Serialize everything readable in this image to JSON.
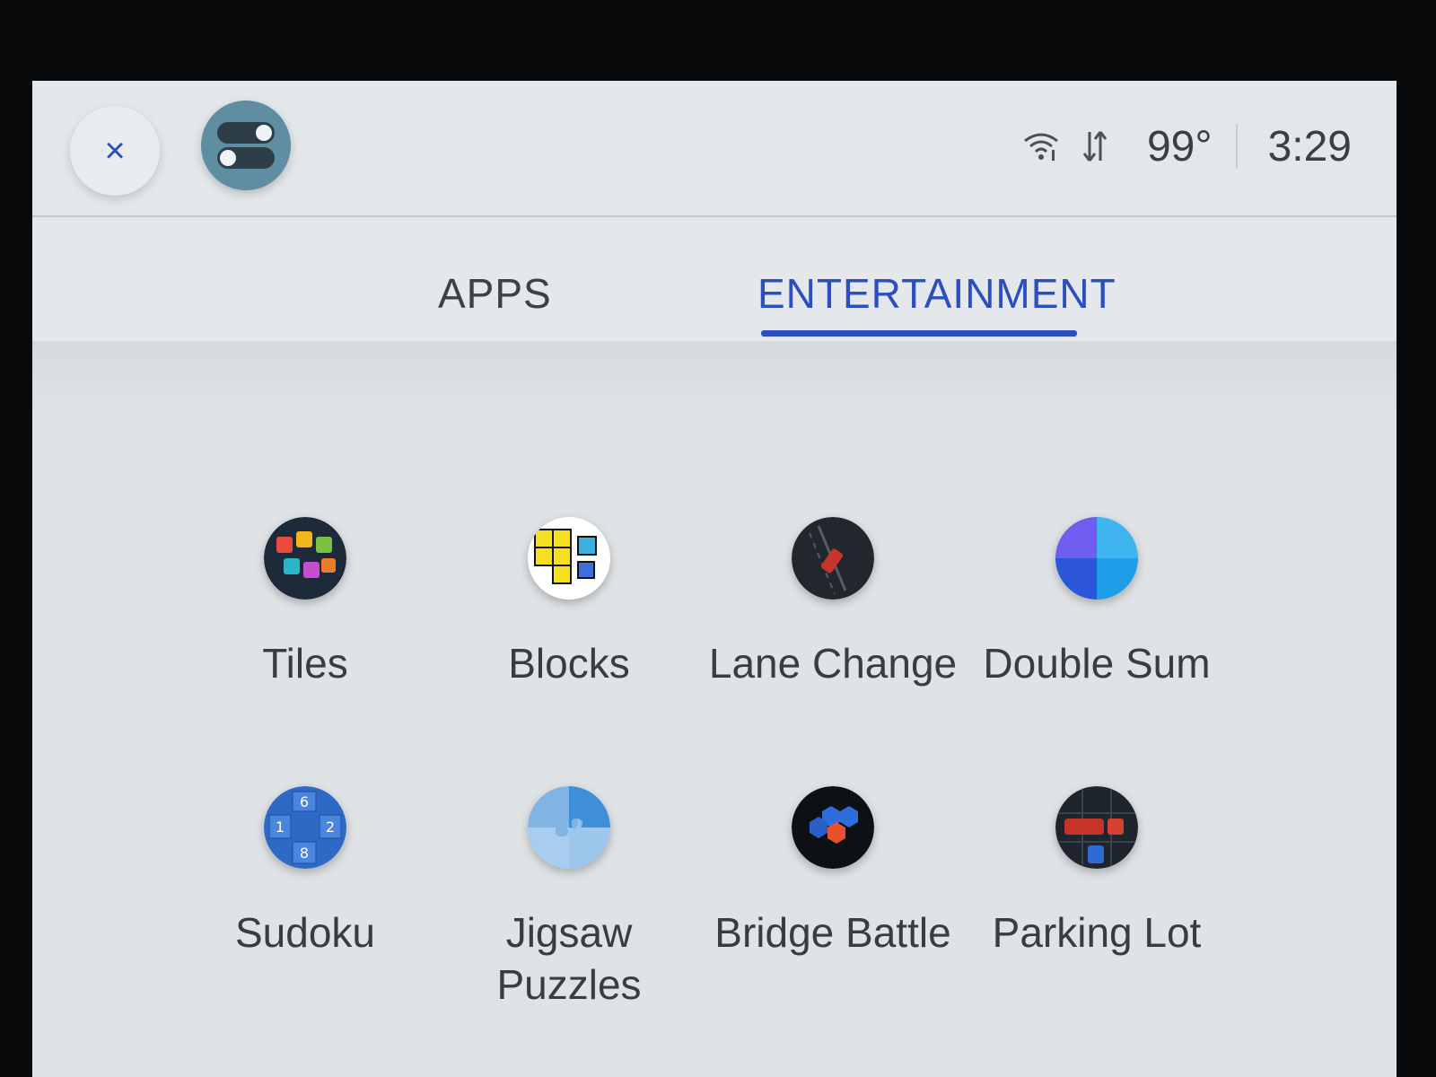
{
  "header": {
    "close_icon": "×",
    "temperature": "99°",
    "time": "3:29"
  },
  "tabs": [
    {
      "label": "APPS",
      "active": false
    },
    {
      "label": "ENTERTAINMENT",
      "active": true
    }
  ],
  "colors": {
    "accent": "#2c4fbd"
  },
  "apps": [
    {
      "label": "Tiles",
      "icon": "tiles-icon"
    },
    {
      "label": "Blocks",
      "icon": "blocks-icon"
    },
    {
      "label": "Lane Change",
      "icon": "lane-change-icon"
    },
    {
      "label": "Double Sum",
      "icon": "double-sum-icon"
    },
    {
      "label": "Sudoku",
      "icon": "sudoku-icon"
    },
    {
      "label": "Jigsaw Puzzles",
      "icon": "jigsaw-icon"
    },
    {
      "label": "Bridge Battle",
      "icon": "bridge-battle-icon"
    },
    {
      "label": "Parking Lot",
      "icon": "parking-lot-icon"
    }
  ]
}
